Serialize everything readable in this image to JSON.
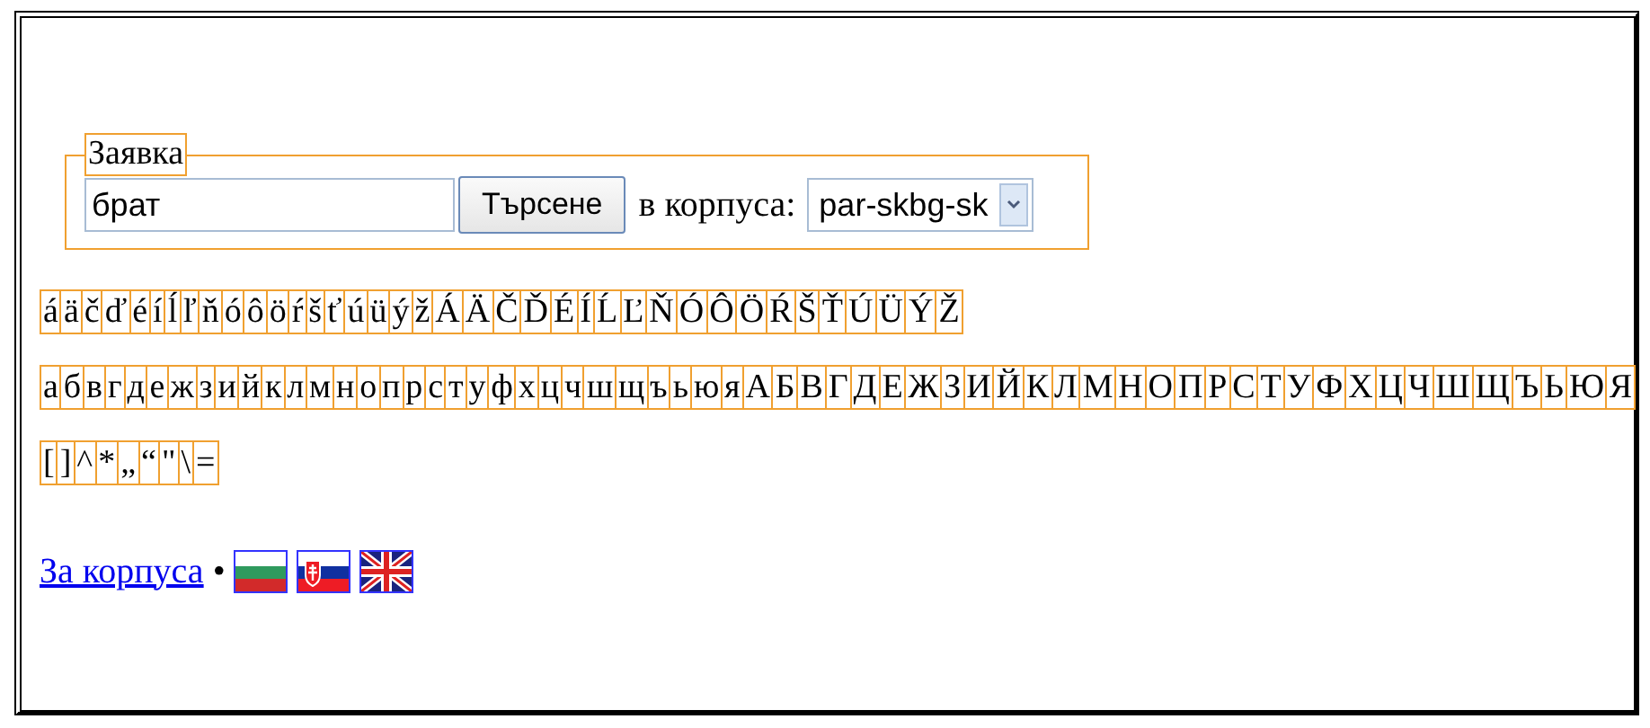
{
  "query_form": {
    "legend": "Заявка",
    "query": "брат",
    "search_button": "Търсене",
    "corpus_label": "в корпуса:",
    "corpus": "par-skbg-sk"
  },
  "keyboard_rows": [
    [
      "á",
      "ä",
      "č",
      "ď",
      "é",
      "í",
      "ĺ",
      "ľ",
      "ň",
      "ó",
      "ô",
      "ö",
      "ŕ",
      "š",
      "ť",
      "ú",
      "ü",
      "ý",
      "ž",
      "Á",
      "Ä",
      "Č",
      "Ď",
      "É",
      "Í",
      "Ĺ",
      "Ľ",
      "Ň",
      "Ó",
      "Ô",
      "Ö",
      "Ŕ",
      "Š",
      "Ť",
      "Ú",
      "Ü",
      "Ý",
      "Ž"
    ],
    [
      "а",
      "б",
      "в",
      "г",
      "д",
      "е",
      "ж",
      "з",
      "и",
      "й",
      "к",
      "л",
      "м",
      "н",
      "о",
      "п",
      "р",
      "с",
      "т",
      "у",
      "ф",
      "х",
      "ц",
      "ч",
      "ш",
      "щ",
      "ъ",
      "ь",
      "ю",
      "я",
      "А",
      "Б",
      "В",
      "Г",
      "Д",
      "Е",
      "Ж",
      "З",
      "И",
      "Й",
      "К",
      "Л",
      "М",
      "Н",
      "О",
      "П",
      "Р",
      "С",
      "Т",
      "У",
      "Ф",
      "Х",
      "Ц",
      "Ч",
      "Ш",
      "Щ",
      "Ъ",
      "Ь",
      "Ю",
      "Я"
    ],
    [
      "[",
      "]",
      "^",
      "*",
      "„",
      "“",
      "\"",
      "\\",
      "="
    ]
  ],
  "footer": {
    "link": "За корпуса",
    "separator": "•",
    "flags": [
      {
        "kind": "tricolor"
      },
      {
        "kind": "cross-tricolor"
      },
      {
        "kind": "union"
      }
    ]
  }
}
